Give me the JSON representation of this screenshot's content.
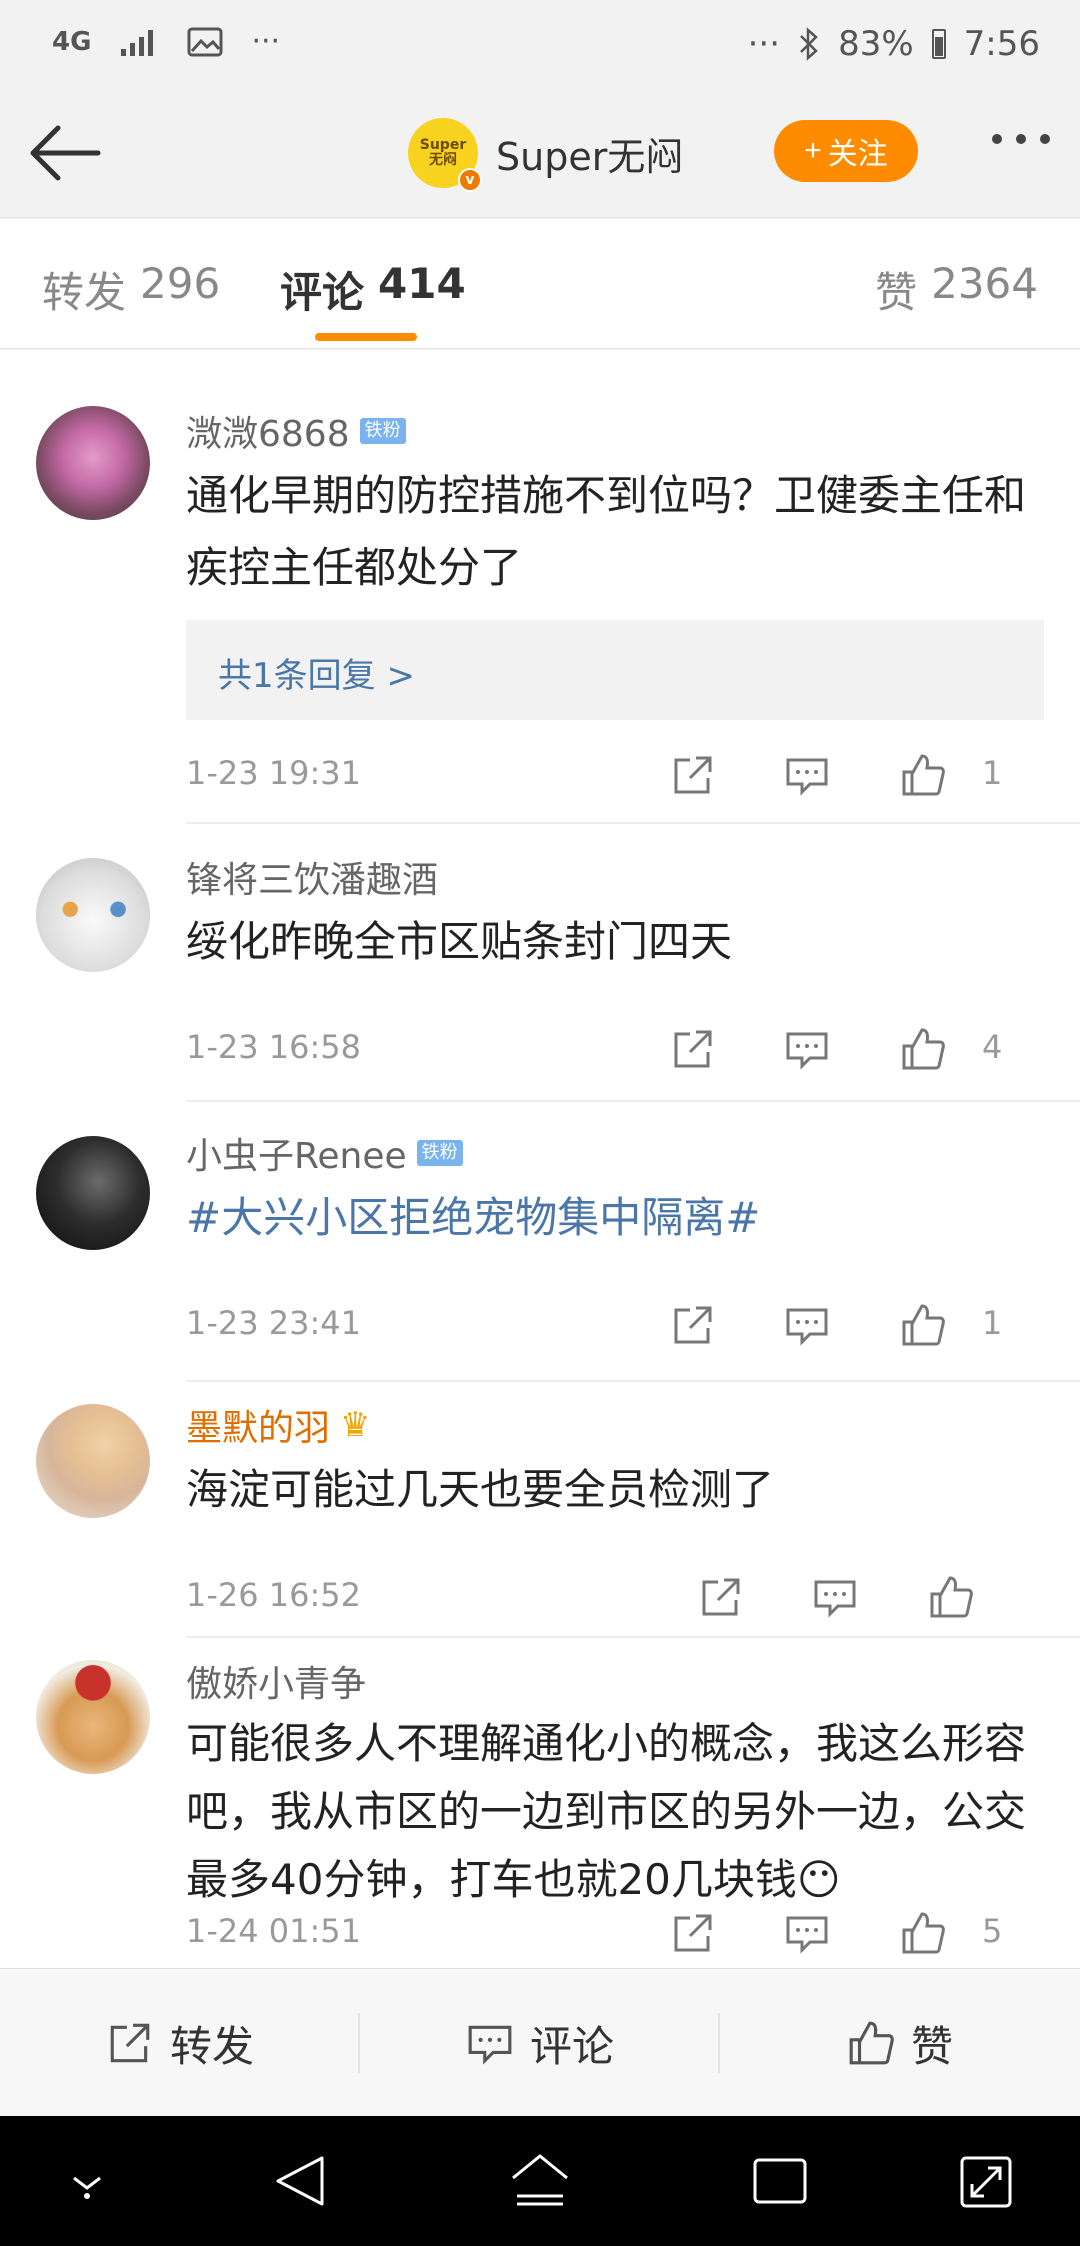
{
  "status_bar": {
    "network": "4G",
    "signal_icon": "signal-icon",
    "gallery_icon": "image-icon",
    "left_dots": "···",
    "right_dots": "···",
    "bluetooth_icon": "bluetooth-icon",
    "battery_percent": "83%",
    "time": "7:56"
  },
  "header": {
    "account_name": "Super无闷",
    "avatar_text": "Super\n无闷",
    "verified_mark": "v",
    "follow_label": "关注",
    "follow_plus": "+"
  },
  "tabs": [
    {
      "label": "转发",
      "count": "296"
    },
    {
      "label": "评论",
      "count": "414"
    },
    {
      "label": "赞",
      "count": "2364"
    }
  ],
  "comments": [
    {
      "user": "溦溦6868",
      "badge": "铁粉",
      "text": "通化早期的防控措施不到位吗？卫健委主任和疾控主任都处分了",
      "reply_summary": "共1条回复 >",
      "time": "1-23 19:31",
      "likes": "1"
    },
    {
      "user": "锋将三饮潘趣酒",
      "badge": "",
      "text": "绥化昨晚全市区贴条封门四天",
      "time": "1-23 16:58",
      "likes": "4"
    },
    {
      "user": "小虫子Renee",
      "badge": "铁粉",
      "text": "#大兴小区拒绝宠物集中隔离#",
      "time": "1-23 23:41",
      "likes": "1"
    },
    {
      "user": "墨默的羽",
      "badge": "",
      "text": "海淀可能过几天也要全员检测了",
      "time": "1-26 16:52",
      "likes": ""
    },
    {
      "user": "傲娇小青争",
      "badge": "",
      "text": "可能很多人不理解通化小的概念，我这么形容吧，我从市区的一边到市区的另外一边，公交最多40分钟，打车也就20几块钱😶",
      "time": "1-24 01:51",
      "likes": "5"
    }
  ],
  "bottom_bar": {
    "repost": "转发",
    "comment": "评论",
    "like": "赞"
  },
  "colors": {
    "accent": "#ff8c00",
    "link": "#4a76a8",
    "badge": "#79b4ef"
  }
}
